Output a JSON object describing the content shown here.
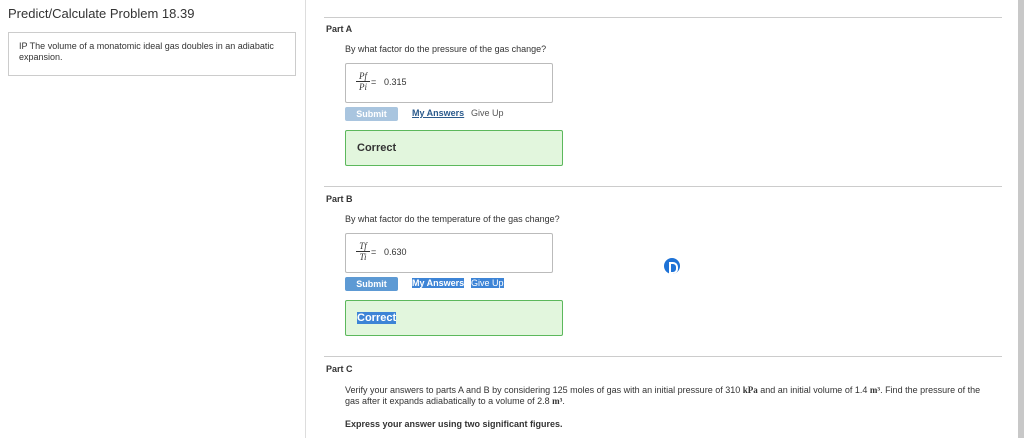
{
  "problem": {
    "title": "Predict/Calculate Problem 18.39",
    "statement": "IP The volume of a monatomic ideal gas doubles in an adiabatic expansion."
  },
  "part_a": {
    "title": "Part A",
    "question": "By what factor do the pressure of the gas change?",
    "fraction_top": "Pf",
    "fraction_bottom": "Pi",
    "equals": "=",
    "answer": "0.315",
    "submit_label": "Submit",
    "my_answers_label": "My Answers",
    "give_up_label": "Give Up",
    "feedback": "Correct"
  },
  "part_b": {
    "title": "Part B",
    "question": "By what factor do the temperature of the gas change?",
    "fraction_top": "Tf",
    "fraction_bottom": "Ti",
    "equals": "=",
    "answer": "0.630",
    "submit_label": "Submit",
    "my_answers_label": "My Answers",
    "give_up_label": "Give Up",
    "feedback": "Correct"
  },
  "part_c": {
    "title": "Part C",
    "text_1": "Verify your answers to parts A and B by considering 125 moles of gas with an initial pressure of 310",
    "unit_pressure": "kPa",
    "text_2": "and an initial volume of 1.4",
    "unit_volume": "m³",
    "text_3": ". Find the pressure of the gas after it expands adiabatically to a volume of 2.8",
    "unit_volume_2": "m³",
    "text_4": ".",
    "instruction": "Express your answer using two significant figures."
  },
  "colors": {
    "feedback_border": "#5cb85c",
    "feedback_bg": "#e2f6dd",
    "selection": "#3d84d6",
    "submit_disabled": "#a9c5df"
  },
  "icons": {
    "extension": "blue-circle-d-icon"
  }
}
